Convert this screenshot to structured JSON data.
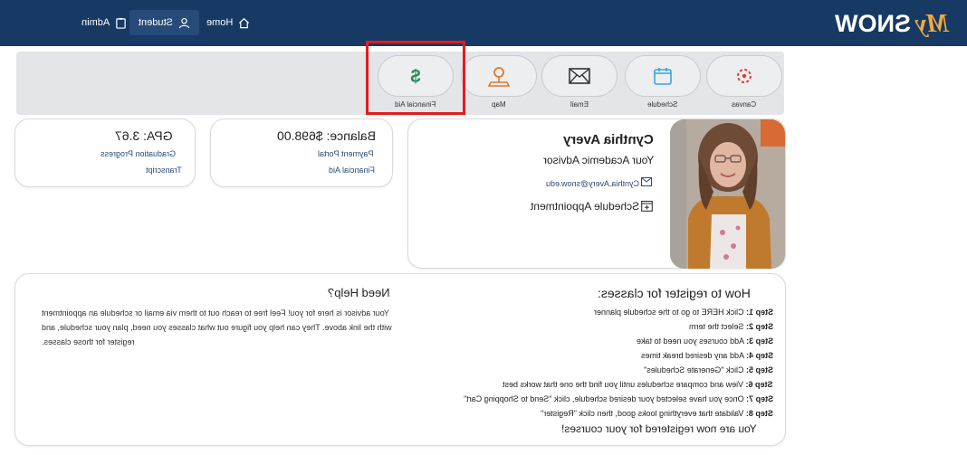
{
  "nav": {
    "home_label": "Home",
    "student_label": "Student",
    "admin_label": "Admin"
  },
  "brand": {
    "logo_text": "MySNOW",
    "accent": "#f3a93c",
    "navy": "#173a64"
  },
  "quick_links": [
    {
      "label": "Canvas",
      "icon": "canvas-icon"
    },
    {
      "label": "Schedule",
      "icon": "calendar-icon"
    },
    {
      "label": "Email",
      "icon": "envelope-icon"
    },
    {
      "label": "Map",
      "icon": "map-pin-icon"
    },
    {
      "label": "Financial Aid",
      "icon": "dollar-icon"
    }
  ],
  "gpa_card": {
    "title": "GPA: 3.67",
    "links": [
      "Graduation Progress",
      "Transcript"
    ]
  },
  "balance_card": {
    "title": "Balance: $698.00",
    "links": [
      "Payment Portal",
      "Financial Aid"
    ]
  },
  "advisor": {
    "name": "Cynthia Avery",
    "role": "Your Academic Advisor",
    "email": "Cynthia.Avery@snow.edu",
    "appointment_label": "Schedule Appointment"
  },
  "help": {
    "title": "Need Help?",
    "text": "Your advisor is here for you! Feel free to reach out to them via email or schedule an appointment with the link above. They can help you figure out what classes you need, plan your schedule, and register for those classes."
  },
  "register": {
    "title": "How to register for classes:",
    "steps": [
      {
        "label": "Step 1:",
        "text": "Click HERE to go to the schedule planner"
      },
      {
        "label": "Step 2:",
        "text": "Select the term"
      },
      {
        "label": "Step 3:",
        "text": "Add courses you need to take"
      },
      {
        "label": "Step 4:",
        "text": "Add any desired break times"
      },
      {
        "label": "Step 5:",
        "text": "Click \"Generate Schedules\""
      },
      {
        "label": "Step 6:",
        "text": "View and compare schedules until you find the one that works best"
      },
      {
        "label": "Step 7:",
        "text": "Once you have selected your desired schedule, click \"Send to Shopping Cart\""
      },
      {
        "label": "Step 8:",
        "text": "Validate that everything looks good, then click \"Register\""
      }
    ],
    "final": "You are now registered for your courses!"
  }
}
